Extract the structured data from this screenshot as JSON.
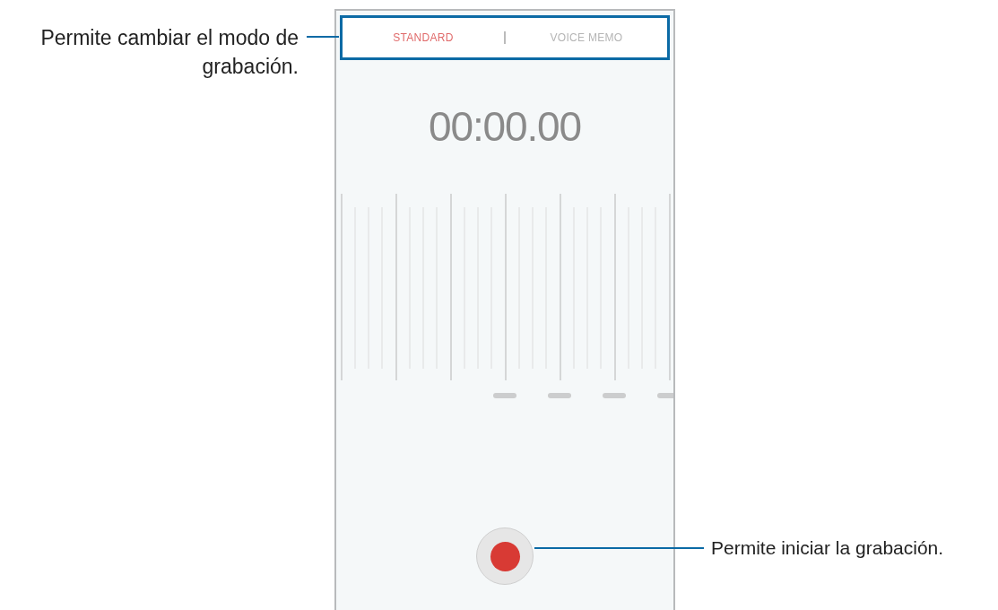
{
  "callouts": [
    {
      "text": "Permite cambiar el modo de grabación."
    },
    {
      "text": "Permite iniciar la grabación."
    }
  ],
  "phone": {
    "tabs": [
      {
        "label": "STANDARD",
        "selected": true
      },
      {
        "label": "VOICE MEMO",
        "selected": false
      }
    ],
    "timer": "00:00.00"
  }
}
